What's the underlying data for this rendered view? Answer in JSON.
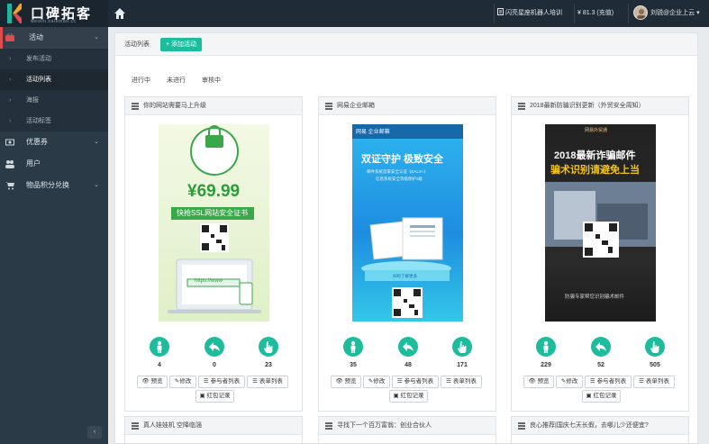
{
  "app": {
    "logo_name": "口碑拓客",
    "logo_sub": "weixin.saleman.cc"
  },
  "topbar": {
    "bot_label": "闪亮星座机器人培训",
    "balance": "¥ 81.3 (充值)",
    "user": "刘锐@企业上云"
  },
  "sidebar": {
    "items": [
      {
        "label": "活动",
        "icon": "activity-icon"
      },
      {
        "label": "发布活动"
      },
      {
        "label": "活动列表"
      },
      {
        "label": "海报"
      },
      {
        "label": "活动标签"
      },
      {
        "label": "优惠券",
        "icon": "coupon-icon"
      },
      {
        "label": "用户",
        "icon": "users-icon"
      },
      {
        "label": "物品积分兑换",
        "icon": "cart-icon"
      }
    ],
    "collapse": "‹"
  },
  "panel": {
    "title": "活动列表",
    "add_button": "+ 添加活动",
    "tabs": [
      "进行中",
      "未进行",
      "审核中"
    ]
  },
  "cards": [
    {
      "title": "你的网站需要马上升级",
      "poster": {
        "ssl": "SSL",
        "price": "¥69.99",
        "ribbon": "快抢SSL网站安全证书",
        "url": "https://www"
      },
      "stats": [
        "4",
        "0",
        "23"
      ]
    },
    {
      "title": "网易企业邮箱",
      "poster": {
        "brand": "网易 企业邮箱",
        "headline": "双证守护  极致安全",
        "sub1": "邮件系统首家安全认证《EAL3+》",
        "sub2": "信息系统安全等级保护3级",
        "foot": "扫码了解更多"
      },
      "stats": [
        "35",
        "48",
        "171"
      ]
    },
    {
      "title": "2018最新防骗识别更新（外贸安全周知）",
      "poster": {
        "brand": "网易外贸通",
        "line1": "2018最新诈骗邮件",
        "line2": "骗术识别请避免上当",
        "foot": "防骗专家帮您识别骗术邮件"
      },
      "stats": [
        "229",
        "52",
        "505"
      ]
    }
  ],
  "card_buttons": {
    "preview": "预览",
    "edit": "修改",
    "participants": "参与者列表",
    "forms": "表单列表",
    "redpack": "红包记录"
  },
  "bottom_cards": [
    {
      "title": "真人娃娃机 空降临淄"
    },
    {
      "title": "寻找下一个百万富翁：创业合伙人"
    },
    {
      "title": "良心推荐|国庆七天长假，去哪儿少还便宜?"
    }
  ],
  "colors": {
    "accent": "#1cbc9c",
    "sidebar": "#2b3a47",
    "topbar": "#1f2c38",
    "active": "#e04b4b"
  }
}
